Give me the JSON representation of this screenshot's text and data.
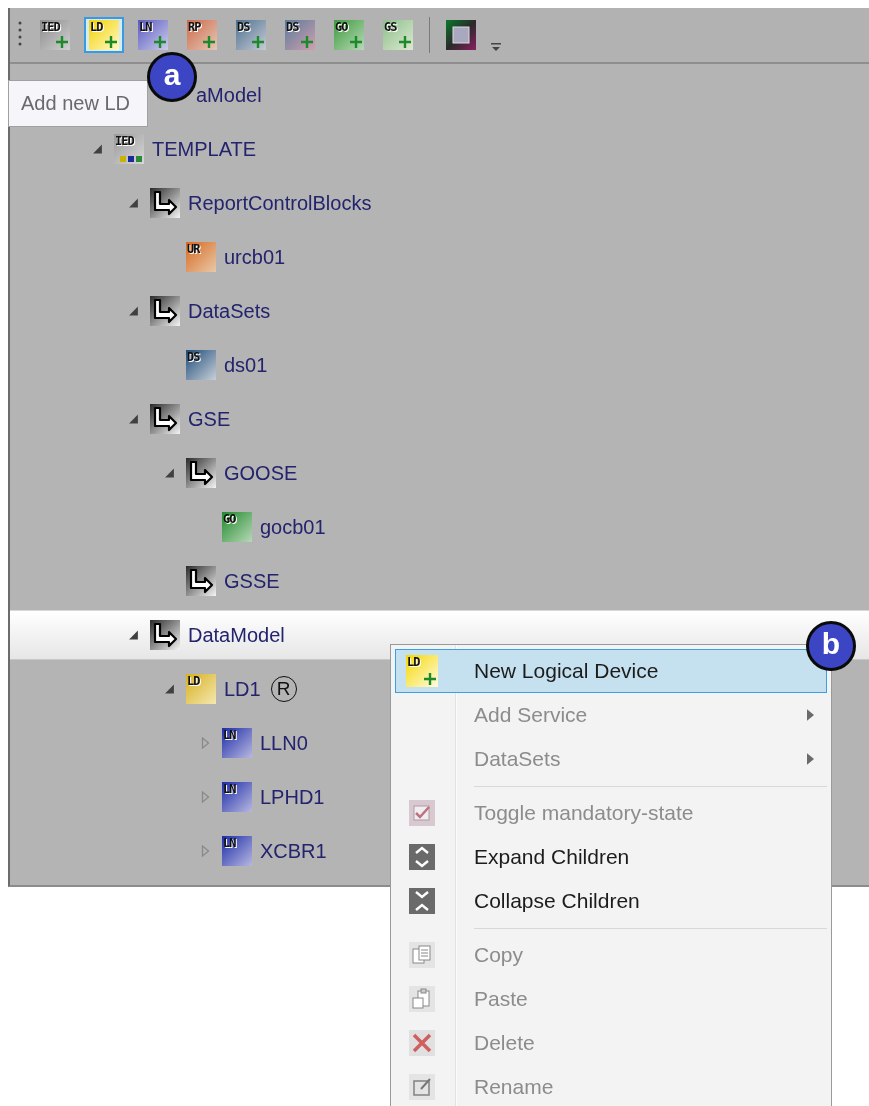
{
  "toolbar": {
    "buttons": [
      {
        "kind": "ied",
        "badge": "IED",
        "selected": false
      },
      {
        "kind": "ld",
        "badge": "LD",
        "selected": true
      },
      {
        "kind": "ln",
        "badge": "LN",
        "selected": false
      },
      {
        "kind": "rp",
        "badge": "RP",
        "selected": false
      },
      {
        "kind": "ds",
        "badge": "DS",
        "selected": false
      },
      {
        "kind": "ds2",
        "badge": "DS",
        "selected": false
      },
      {
        "kind": "go",
        "badge": "GO",
        "selected": false
      },
      {
        "kind": "gs",
        "badge": "GS",
        "selected": false
      },
      {
        "kind": "frame",
        "selected": false
      }
    ]
  },
  "tooltip": {
    "text": "Add new LD"
  },
  "tree": [
    {
      "label": "aModel",
      "selected": false,
      "children": [
        {
          "label": "TEMPLATE",
          "expanded": true,
          "kind": "ied",
          "badge": "IED",
          "selected": false,
          "children": [
            {
              "label": "ReportControlBlocks",
              "expanded": true,
              "kind": "folder",
              "selected": false,
              "children": [
                {
                  "label": "urcb01",
                  "kind": "urcb",
                  "badge": "UR",
                  "selected": false
                }
              ]
            },
            {
              "label": "DataSets",
              "expanded": true,
              "kind": "folder",
              "selected": false,
              "children": [
                {
                  "label": "ds01",
                  "kind": "ds",
                  "badge": "DS",
                  "selected": false
                }
              ]
            },
            {
              "label": "GSE",
              "expanded": true,
              "kind": "folder",
              "selected": false,
              "children": [
                {
                  "label": "GOOSE",
                  "expanded": true,
                  "kind": "folder",
                  "selected": false,
                  "children": [
                    {
                      "label": "gocb01",
                      "kind": "go",
                      "badge": "GO",
                      "selected": false
                    }
                  ]
                },
                {
                  "label": "GSSE",
                  "kind": "folder",
                  "selected": false
                }
              ]
            },
            {
              "label": "DataModel",
              "expanded": true,
              "kind": "folder",
              "selected": true,
              "children": [
                {
                  "label": "LD1",
                  "expanded": true,
                  "kind": "ld",
                  "badge": "LD",
                  "tag": "R",
                  "selected": false,
                  "children": [
                    {
                      "label": "LLN0",
                      "expanded": false,
                      "kind": "ln",
                      "badge": "LN",
                      "selected": false
                    },
                    {
                      "label": "LPHD1",
                      "expanded": false,
                      "kind": "ln",
                      "badge": "LN",
                      "selected": false
                    },
                    {
                      "label": "XCBR1",
                      "expanded": false,
                      "kind": "ln",
                      "badge": "LN",
                      "selected": false
                    }
                  ]
                }
              ]
            }
          ]
        }
      ]
    }
  ],
  "context_menu": [
    {
      "kind": "ld-add",
      "label": "New Logical Device",
      "badge": "LD",
      "enabled": true,
      "selected": true,
      "submenu": false
    },
    {
      "kind": "plain",
      "label": "Add Service",
      "enabled": false,
      "selected": false,
      "submenu": true
    },
    {
      "kind": "plain",
      "label": "DataSets",
      "enabled": false,
      "selected": false,
      "submenu": true
    },
    {
      "kind": "separator"
    },
    {
      "kind": "check",
      "label": "Toggle mandatory-state",
      "enabled": false,
      "selected": false,
      "submenu": false
    },
    {
      "kind": "expand",
      "label": "Expand Children",
      "enabled": true,
      "selected": false,
      "submenu": false
    },
    {
      "kind": "collapse",
      "label": "Collapse Children",
      "enabled": true,
      "selected": false,
      "submenu": false
    },
    {
      "kind": "separator"
    },
    {
      "kind": "copy",
      "label": "Copy",
      "enabled": false,
      "selected": false,
      "submenu": false
    },
    {
      "kind": "paste",
      "label": "Paste",
      "enabled": false,
      "selected": false,
      "submenu": false
    },
    {
      "kind": "delete",
      "label": "Delete",
      "enabled": false,
      "selected": false,
      "submenu": false
    },
    {
      "kind": "rename",
      "label": "Rename",
      "enabled": false,
      "selected": false,
      "submenu": false
    }
  ],
  "annotations": [
    {
      "label": "a"
    },
    {
      "label": "b"
    }
  ]
}
